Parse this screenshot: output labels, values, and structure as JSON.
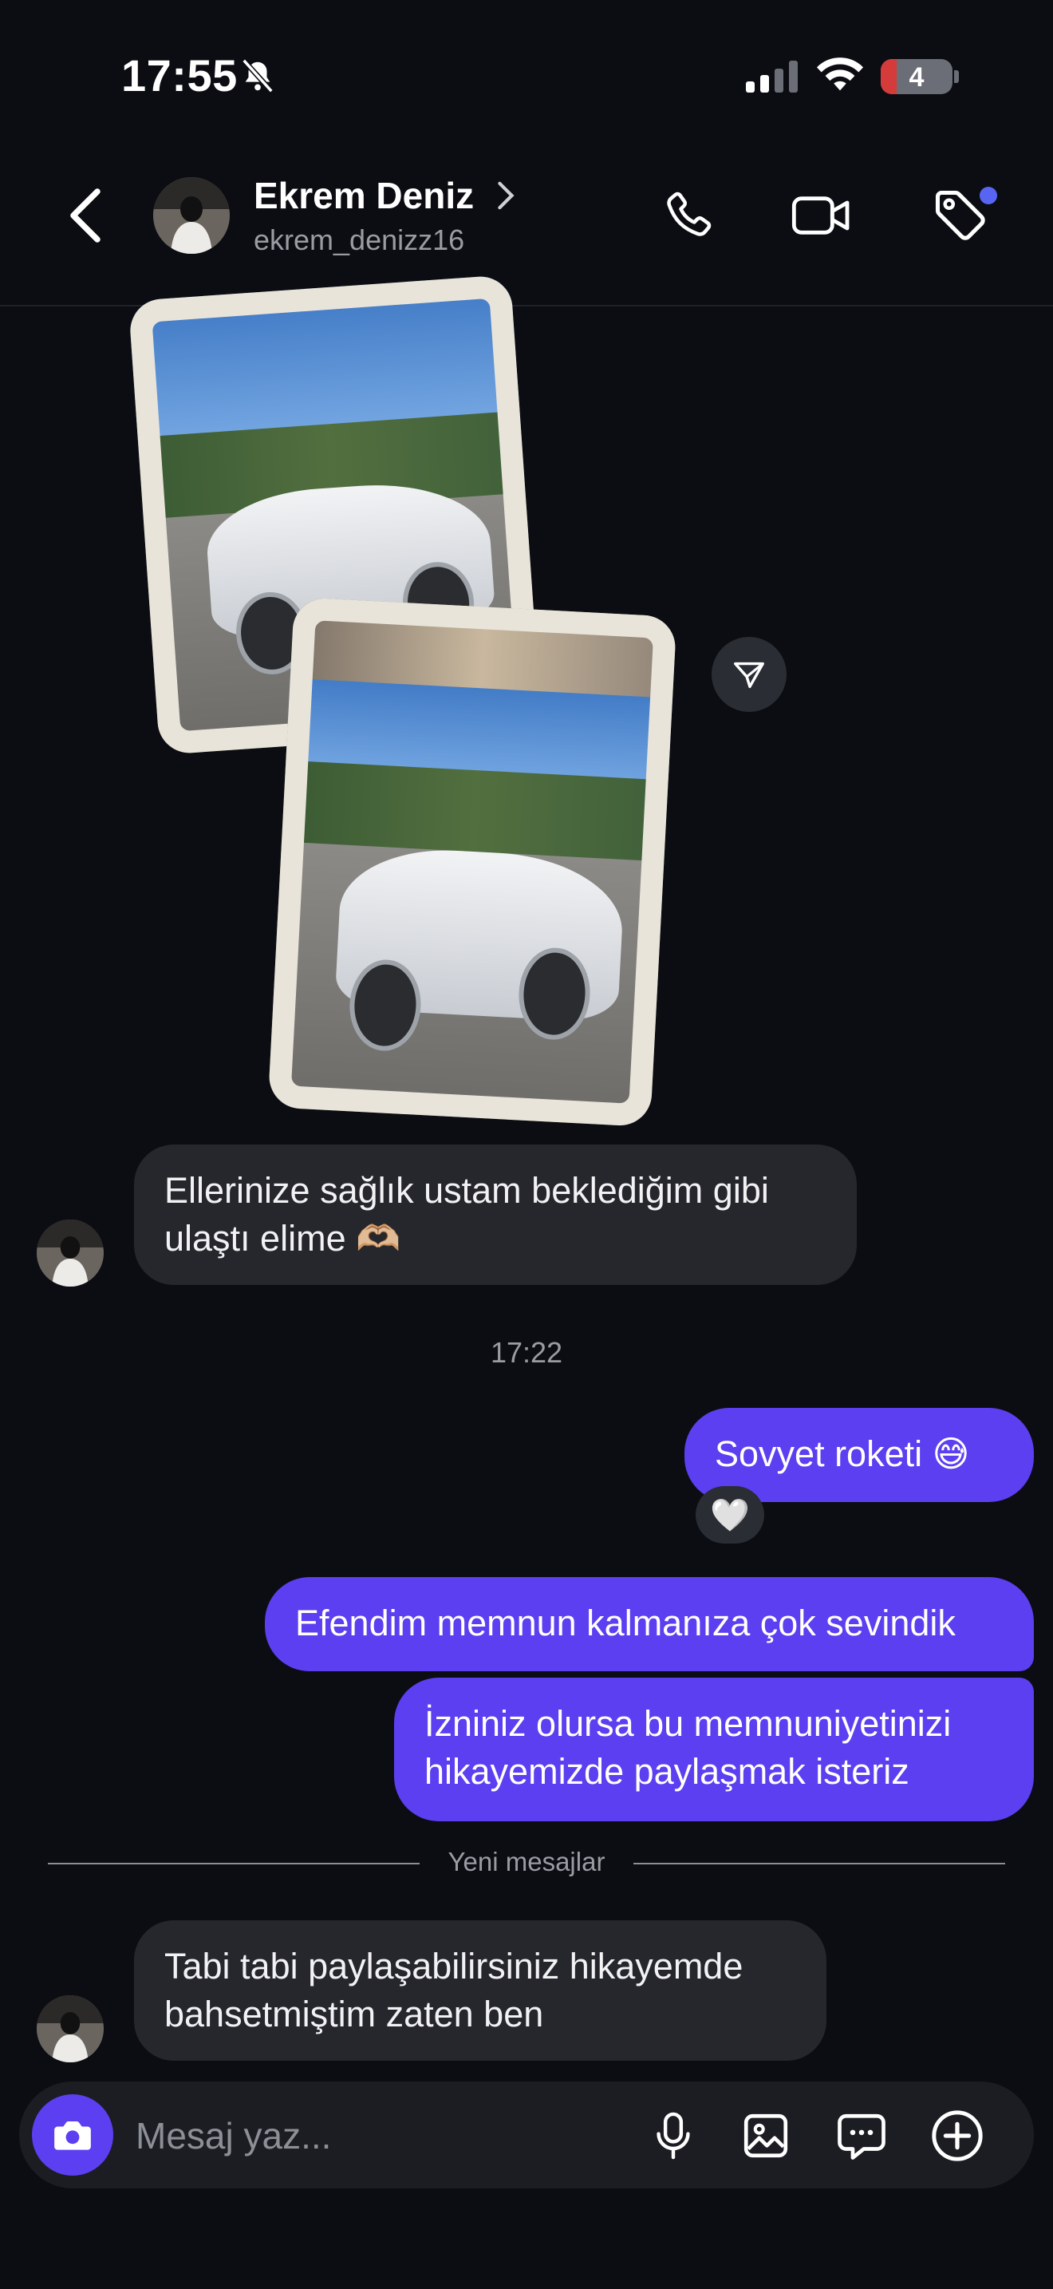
{
  "status_bar": {
    "time": "17:55",
    "battery": "4"
  },
  "header": {
    "name": "Ekrem Deniz",
    "username": "ekrem_denizz16"
  },
  "messages": {
    "in_1": "Ellerinize sağlık ustam beklediğim gibi ulaştı elime 🫶🏼",
    "timestamp": "17:22",
    "out_1": "Sovyet roketi 😅",
    "reaction": "🤍",
    "out_2": "Efendim memnun kalmanıza çok sevindik",
    "out_3": "İzniniz olursa bu memnuniyetinizi hikayemizde paylaşmak isteriz",
    "new_messages_label": "Yeni mesajlar",
    "in_2": "Tabi tabi paylaşabilirsiniz hikayemde bahsetmiştim zaten ben"
  },
  "composer": {
    "placeholder": "Mesaj yaz..."
  },
  "colors": {
    "accent": "#5b3ff0",
    "background": "#0b0d12",
    "incoming_bubble": "#25272d"
  }
}
